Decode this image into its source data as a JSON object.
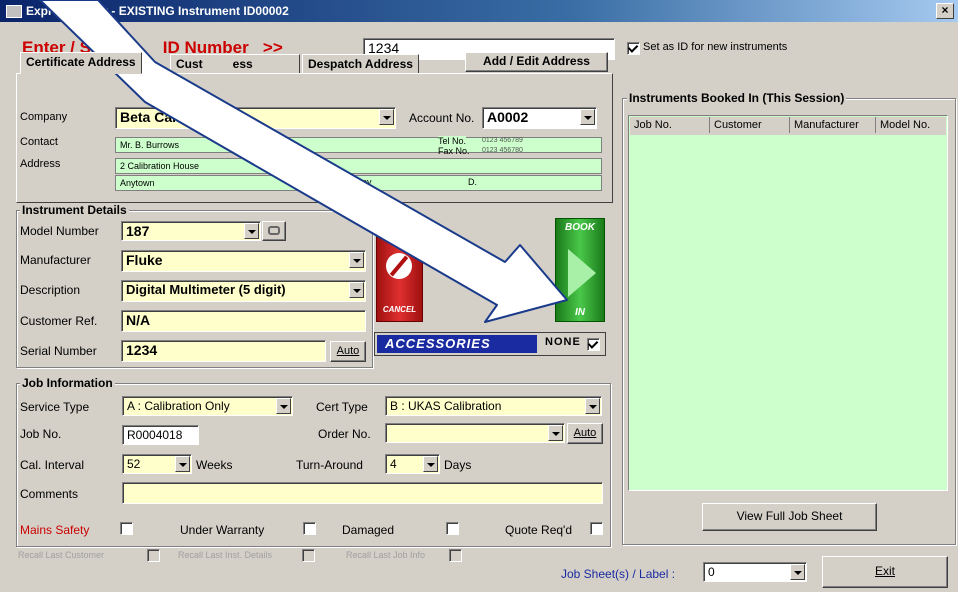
{
  "window": {
    "title": "Expre        By User  - EXISTING Instrument ID00002",
    "close": "×"
  },
  "scan": {
    "label": "Enter / Scan         ID Number   >>",
    "value": "1234",
    "set_as_id_label": "Set as ID for new instruments",
    "set_as_id_checked": true
  },
  "tabs": {
    "certificate": "Certificate Address",
    "customer": "Cust         ess",
    "despatch": "Despatch Address",
    "add_edit": "Add / Edit Address"
  },
  "address": {
    "company_label": "Company",
    "company_value": "Beta Calibrations",
    "account_label": "Account No.",
    "account_value": "A0002",
    "contact_label": "Contact",
    "contact_value": "Mr. B. Burrows",
    "tel_label": "Tel No.",
    "tel_value": "0123 456789",
    "fax_label": "Fax No.",
    "fax_value": "0123 456780",
    "address_label": "Address",
    "address_line1": "2 Calibration House",
    "address_line2": "Anytown",
    "address_line2b": "Any",
    "address_line2c": "D."
  },
  "instrument": {
    "group_title": "Instrument Details",
    "model_label": "Model Number",
    "model_value": "187",
    "manufacturer_label": "Manufacturer",
    "manufacturer_value": "Fluke",
    "description_label": "Description",
    "description_value": "Digital Multimeter (5 digit)",
    "custref_label": "Customer Ref.",
    "custref_value": "N/A",
    "serial_label": "Serial Number",
    "serial_value": "1234",
    "auto_label": "Auto"
  },
  "actions": {
    "cancel_top": "CANCEL",
    "cancel_bottom": "CANCEL",
    "book_top": "BOOK",
    "book_bottom": "IN",
    "accessories_label": "ACCESSORIES",
    "accessories_none": "NONE",
    "accessories_none_checked": true
  },
  "job": {
    "group_title": "Job Information",
    "service_label": "Service Type",
    "service_value": "A : Calibration Only",
    "cert_label": "Cert Type",
    "cert_value": "B : UKAS Calibration",
    "jobno_label": "Job No.",
    "jobno_value": "R0004018",
    "order_label": "Order No.",
    "order_value": "",
    "order_auto": "Auto",
    "interval_label": "Cal. Interval",
    "interval_value": "52",
    "weeks_label": "Weeks",
    "turnaround_label": "Turn-Around",
    "turnaround_value": "4",
    "days_label": "Days",
    "comments_label": "Comments",
    "comments_value": "",
    "mains_label": "Mains Safety",
    "warranty_label": "Under Warranty",
    "damaged_label": "Damaged",
    "quote_label": "Quote Req'd"
  },
  "recall": {
    "customer": "Recall Last Customer",
    "inst": "Recall Last Inst. Details",
    "job": "Recall Last Job Info"
  },
  "booked": {
    "group_title": "Instruments Booked In (This Session)",
    "columns": [
      "Job No.",
      "Customer",
      "Manufacturer",
      "Model No."
    ],
    "view_button": "View Full Job Sheet"
  },
  "footer": {
    "jobsheet_label": "Job Sheet(s) / Label :",
    "jobsheet_value": "0",
    "exit_label": "Exit"
  },
  "colors": {
    "title_red": "#cc0000",
    "field_yellow": "#ffffcc",
    "field_green": "#ccffcc",
    "accessories_blue": "#1a2aa0"
  }
}
